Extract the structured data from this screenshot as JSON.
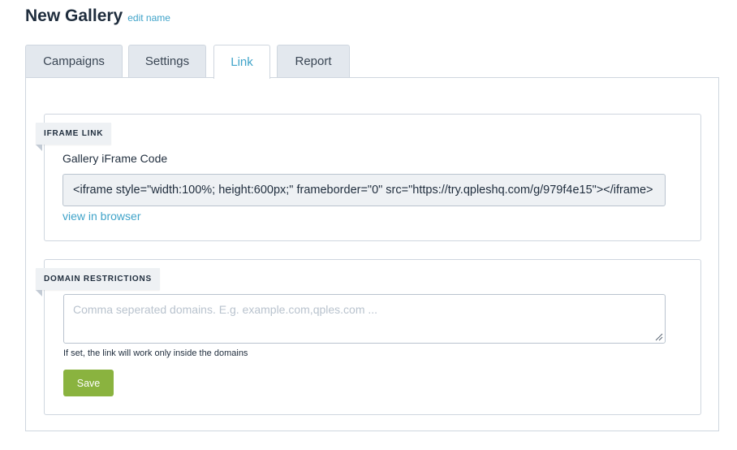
{
  "header": {
    "title": "New Gallery",
    "edit_label": "edit name"
  },
  "tabs": [
    {
      "label": "Campaigns",
      "active": false
    },
    {
      "label": "Settings",
      "active": false
    },
    {
      "label": "Link",
      "active": true
    },
    {
      "label": "Report",
      "active": false
    }
  ],
  "iframe_section": {
    "heading": "IFRAME LINK",
    "field_label": "Gallery iFrame Code",
    "code_value": "<iframe style=\"width:100%; height:600px;\" frameborder=\"0\" src=\"https://try.qpleshq.com/g/979f4e15\"></iframe>",
    "view_link": "view in browser"
  },
  "domain_section": {
    "heading": "DOMAIN RESTRICTIONS",
    "placeholder": "Comma seperated domains. E.g. example.com,qples.com ...",
    "value": "",
    "hint": "If set, the link will work only inside the domains",
    "save_label": "Save"
  },
  "colors": {
    "accent": "#3fa3c9",
    "save_button": "#8ab33f",
    "tab_inactive_bg": "#e3e8ee",
    "border": "#cfd6df"
  }
}
